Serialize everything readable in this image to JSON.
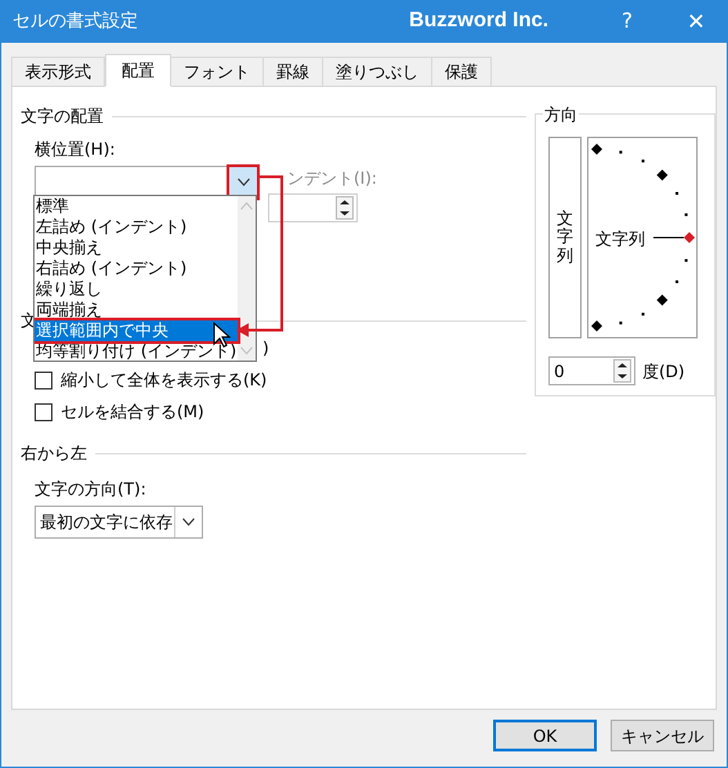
{
  "window": {
    "title": "セルの書式設定",
    "brand": "Buzzword Inc.",
    "help": "?",
    "close": "✕"
  },
  "tabs": [
    {
      "label": "表示形式",
      "selected": false
    },
    {
      "label": "配置",
      "selected": true
    },
    {
      "label": "フォント",
      "selected": false
    },
    {
      "label": "罫線",
      "selected": false
    },
    {
      "label": "塗りつぶし",
      "selected": false
    },
    {
      "label": "保護",
      "selected": false
    }
  ],
  "text_alignment": {
    "heading": "文字の配置",
    "horizontal_label": "横位置(H):",
    "indent_label": "ンデント(I):",
    "hidden_heading_fragment": "文",
    "hidden_fragment": ")"
  },
  "dropdown_list": [
    {
      "label": "標準",
      "selected": false
    },
    {
      "label": "左詰め (インデント)",
      "selected": false
    },
    {
      "label": "中央揃え",
      "selected": false
    },
    {
      "label": "右詰め (インデント)",
      "selected": false
    },
    {
      "label": "繰り返し",
      "selected": false
    },
    {
      "label": "両端揃え",
      "selected": false
    },
    {
      "label": "選択範囲内で中央",
      "selected": true
    },
    {
      "label": "均等割り付け (インデント)",
      "selected": false
    }
  ],
  "checkboxes": [
    {
      "label": "縮小して全体を表示する(K)",
      "checked": false
    },
    {
      "label": "セルを結合する(M)",
      "checked": false
    }
  ],
  "right_to_left": {
    "heading": "右から左",
    "direction_label": "文字の方向(T):",
    "direction_value": "最初の文字に依存"
  },
  "orientation": {
    "heading": "方向",
    "vertical_text": "文字列",
    "dial_text": "文字列",
    "degrees": "0",
    "degrees_label": "度(D)"
  },
  "buttons": [
    {
      "label": "OK",
      "default": true
    },
    {
      "label": "キャンセル",
      "default": false
    }
  ]
}
